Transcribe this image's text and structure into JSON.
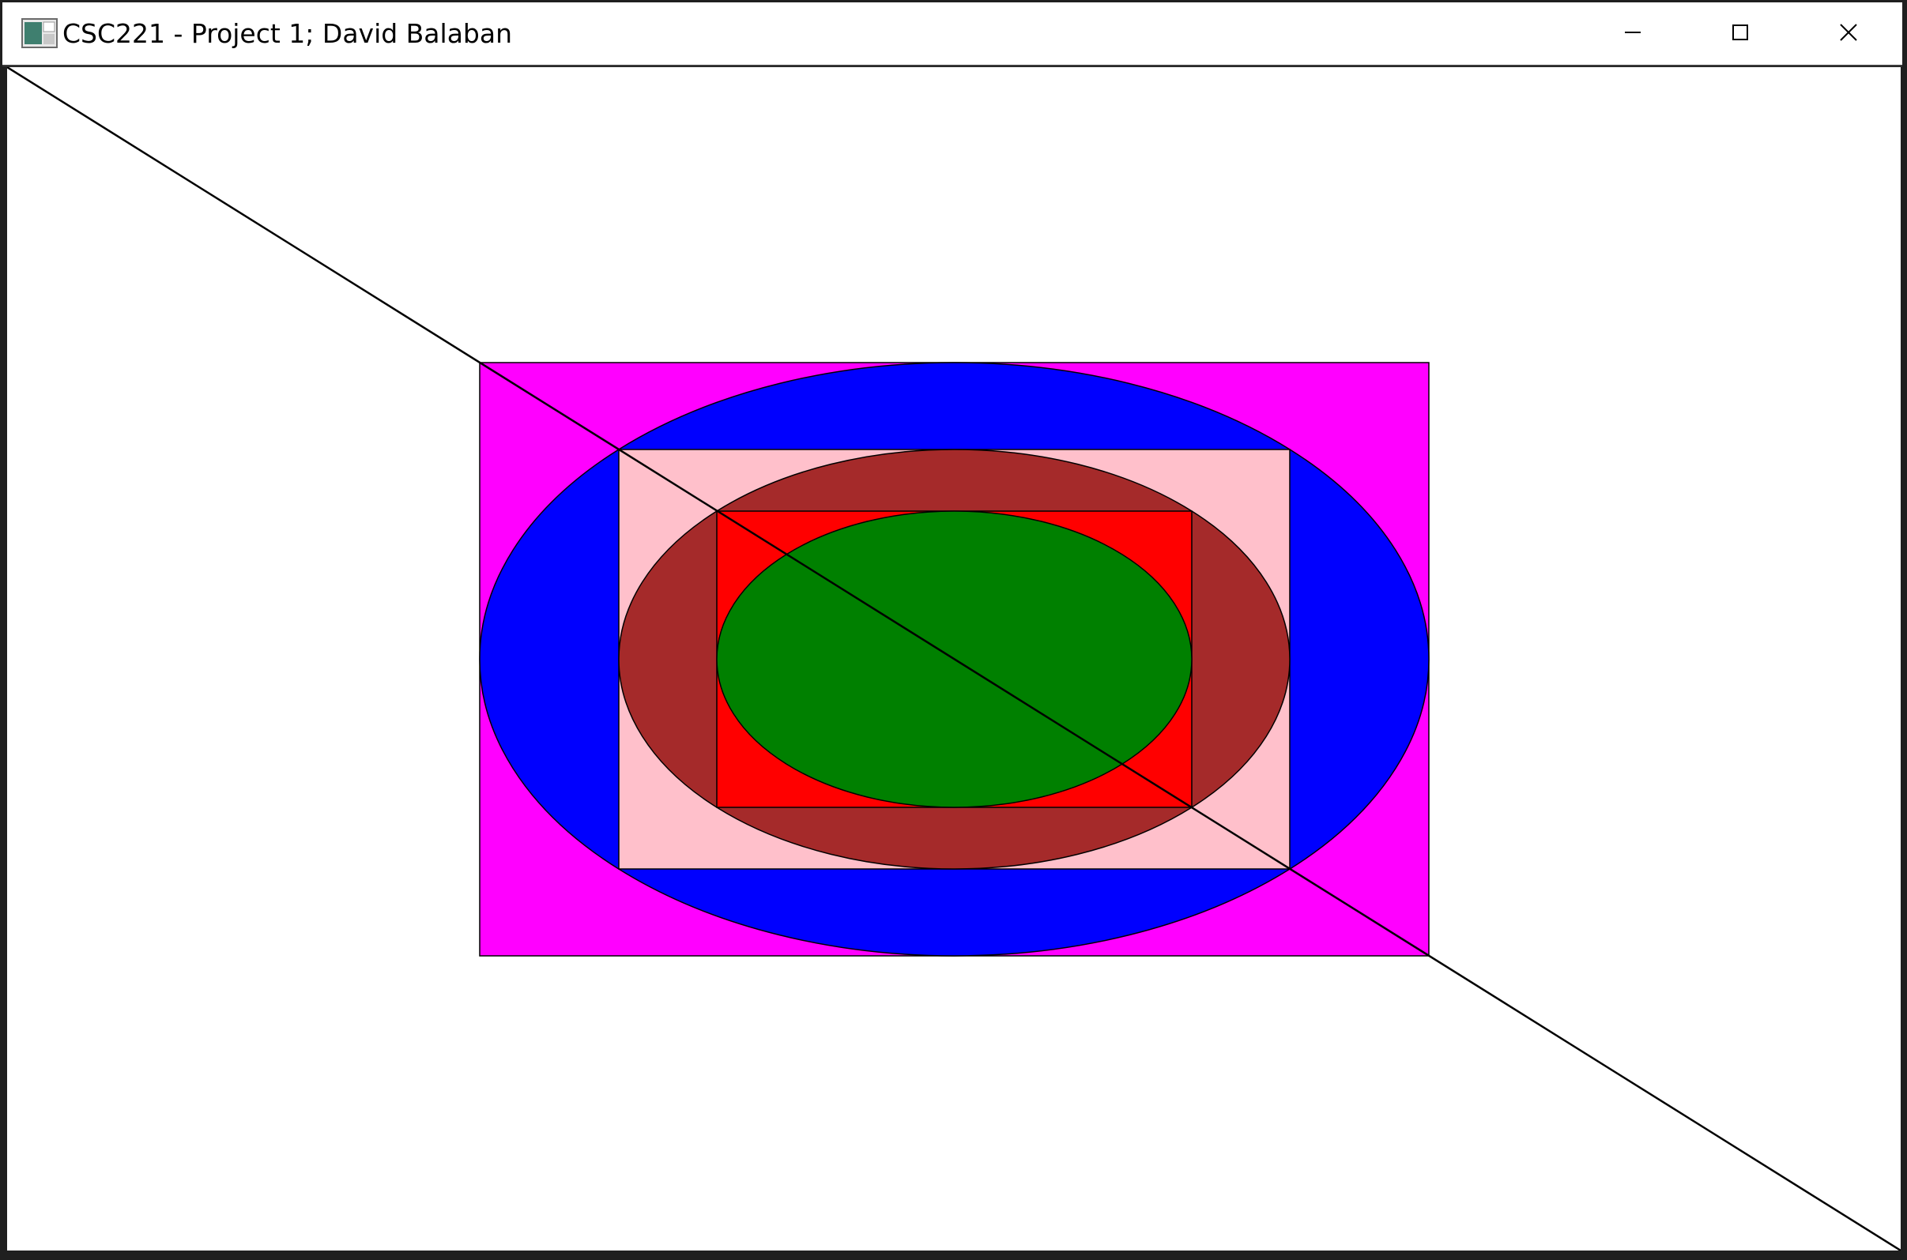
{
  "window": {
    "title": "CSC221 - Project 1; David Balaban",
    "icon": "app-window-icon",
    "controls": {
      "minimize_icon": "minimize-icon",
      "maximize_icon": "maximize-icon",
      "close_icon": "close-icon"
    }
  },
  "canvas": {
    "background": "#ffffff",
    "shapes": [
      {
        "name": "outer-magenta-rectangle",
        "kind": "rect",
        "fill": "#ff00ff"
      },
      {
        "name": "blue-ellipse",
        "kind": "ellipse",
        "fill": "#0000ff"
      },
      {
        "name": "pink-rectangle",
        "kind": "rect",
        "fill": "#ffc0cb"
      },
      {
        "name": "brown-ellipse",
        "kind": "ellipse",
        "fill": "#a52a2a"
      },
      {
        "name": "red-rectangle",
        "kind": "rect",
        "fill": "#ff0000"
      },
      {
        "name": "green-ellipse",
        "kind": "ellipse",
        "fill": "#008000"
      },
      {
        "name": "diagonal-line",
        "kind": "line",
        "stroke": "#000000"
      }
    ]
  }
}
